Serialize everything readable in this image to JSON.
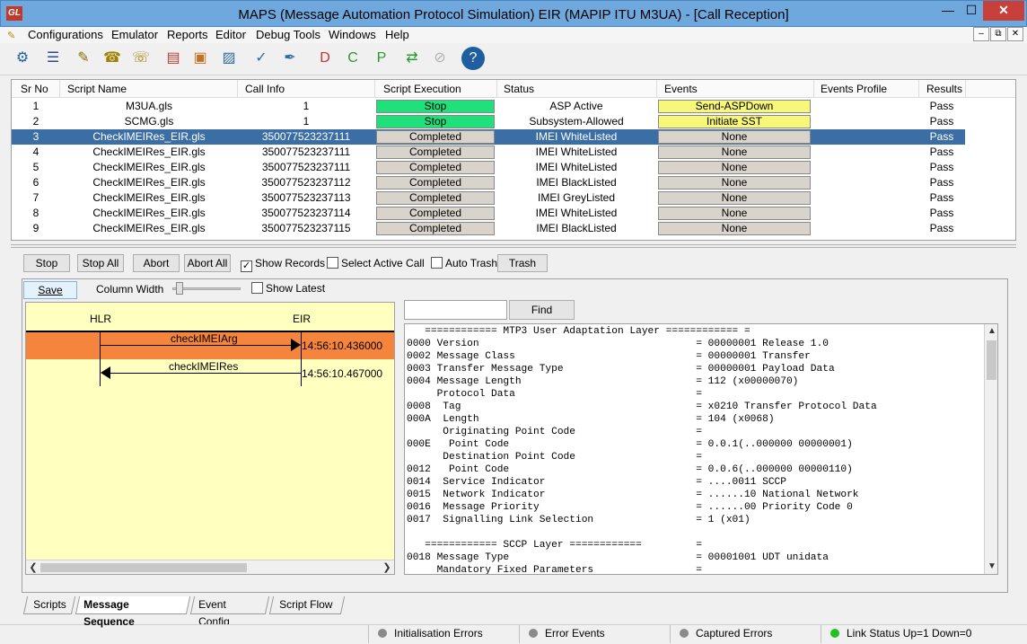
{
  "window": {
    "title": "MAPS (Message Automation Protocol Simulation) EIR (MAPIP ITU M3UA) - [Call Reception]",
    "app_icon": "GL",
    "min_glyph": "—",
    "max_glyph": "☐",
    "close_glyph": "✕"
  },
  "menu": [
    "Configurations",
    "Emulator",
    "Reports",
    "Editor",
    "Debug Tools",
    "Windows",
    "Help"
  ],
  "mdi": {
    "min": "–",
    "restore": "⧉",
    "close": "✕"
  },
  "toolbar": [
    {
      "icon": "gear-icon",
      "glyph": "⚙",
      "color": "#1f5fa0"
    },
    {
      "icon": "notebook-icon",
      "glyph": "☰",
      "color": "#2b4a8c"
    },
    {
      "icon": "script-edit-icon",
      "glyph": "✎",
      "color": "#8a6d00"
    },
    {
      "icon": "phone-icon",
      "glyph": "☎",
      "color": "#a08000"
    },
    {
      "icon": "phones-icon",
      "glyph": "☏",
      "color": "#a08000"
    },
    {
      "icon": "books-icon",
      "glyph": "▤",
      "color": "#c0392b"
    },
    {
      "icon": "briefcase-icon",
      "glyph": "▣",
      "color": "#c87020"
    },
    {
      "icon": "profile-lock-icon",
      "glyph": "▨",
      "color": "#2e6da4"
    },
    {
      "icon": "check-edit-icon",
      "glyph": "✓",
      "color": "#2e6da4"
    },
    {
      "icon": "pen-tool-icon",
      "glyph": "✒",
      "color": "#2e6da4"
    },
    {
      "icon": "record-d-icon",
      "glyph": "D",
      "color": "#d03030"
    },
    {
      "icon": "record-c-icon",
      "glyph": "C",
      "color": "#2a9a2a"
    },
    {
      "icon": "record-p-icon",
      "glyph": "P",
      "color": "#2a9a2a"
    },
    {
      "icon": "clock-arrow-icon",
      "glyph": "⇄",
      "color": "#2a9a2a"
    },
    {
      "icon": "disabled-tool-icon",
      "glyph": "⊘",
      "color": "#b0b0b0"
    },
    {
      "icon": "help-icon",
      "glyph": "?",
      "color": "#1f5fa0"
    }
  ],
  "grid": {
    "headers": [
      "Sr No",
      "Script Name",
      "Call Info",
      "Script Execution",
      "Status",
      "Events",
      "Events Profile",
      "Results"
    ],
    "rows": [
      {
        "sr": "1",
        "name": "M3UA.gls",
        "info": "1",
        "exec": "Stop",
        "status": "ASP Active",
        "events": "Send-ASPDown",
        "result": "Pass",
        "exec_style": "green",
        "events_style": "yellow"
      },
      {
        "sr": "2",
        "name": "SCMG.gls",
        "info": "1",
        "exec": "Stop",
        "status": "Subsystem-Allowed",
        "events": "Initiate SST",
        "result": "Pass",
        "exec_style": "green",
        "events_style": "yellow"
      },
      {
        "sr": "3",
        "name": "CheckIMEIRes_EIR.gls",
        "info": "350077523237111",
        "exec": "Completed",
        "status": "IMEI WhiteListed",
        "events": "None",
        "result": "Pass",
        "selected": true
      },
      {
        "sr": "4",
        "name": "CheckIMEIRes_EIR.gls",
        "info": "350077523237111",
        "exec": "Completed",
        "status": "IMEI WhiteListed",
        "events": "None",
        "result": "Pass"
      },
      {
        "sr": "5",
        "name": "CheckIMEIRes_EIR.gls",
        "info": "350077523237111",
        "exec": "Completed",
        "status": "IMEI WhiteListed",
        "events": "None",
        "result": "Pass"
      },
      {
        "sr": "6",
        "name": "CheckIMEIRes_EIR.gls",
        "info": "350077523237112",
        "exec": "Completed",
        "status": "IMEI BlackListed",
        "events": "None",
        "result": "Pass"
      },
      {
        "sr": "7",
        "name": "CheckIMEIRes_EIR.gls",
        "info": "350077523237113",
        "exec": "Completed",
        "status": "IMEI GreyListed",
        "events": "None",
        "result": "Pass"
      },
      {
        "sr": "8",
        "name": "CheckIMEIRes_EIR.gls",
        "info": "350077523237114",
        "exec": "Completed",
        "status": "IMEI WhiteListed",
        "events": "None",
        "result": "Pass"
      },
      {
        "sr": "9",
        "name": "CheckIMEIRes_EIR.gls",
        "info": "350077523237115",
        "exec": "Completed",
        "status": "IMEI BlackListed",
        "events": "None",
        "result": "Pass"
      }
    ]
  },
  "actions": {
    "stop": "Stop",
    "stop_all": "Stop All",
    "abort": "Abort",
    "abort_all": "Abort All",
    "show_records": "Show Records",
    "show_records_checked": true,
    "select_active_call": "Select Active Call",
    "auto_trash": "Auto Trash",
    "trash": "Trash"
  },
  "panel": {
    "save": "Save",
    "column_width": "Column Width",
    "show_latest": "Show Latest",
    "find": "Find",
    "find_value": ""
  },
  "sequence": {
    "nodes": [
      "HLR",
      "EIR"
    ],
    "messages": [
      {
        "label": "checkIMEIArg",
        "time": "14:56:10.436000",
        "direction": "right",
        "highlighted": true
      },
      {
        "label": "checkIMEIRes",
        "time": "14:56:10.467000",
        "direction": "left",
        "highlighted": false
      }
    ]
  },
  "decode": [
    "   ============ MTP3 User Adaptation Layer ============ =",
    "0000 Version                                    = 00000001 Release 1.0",
    "0002 Message Class                              = 00000001 Transfer",
    "0003 Transfer Message Type                      = 00000001 Payload Data",
    "0004 Message Length                             = 112 (x00000070)",
    "     Protocol Data                              =",
    "0008  Tag                                       = x0210 Transfer Protocol Data",
    "000A  Length                                    = 104 (x0068)",
    "      Originating Point Code                    =",
    "000E   Point Code                               = 0.0.1(..000000 00000001)",
    "      Destination Point Code                    =",
    "0012   Point Code                               = 0.0.6(..000000 00000110)",
    "0014  Service Indicator                         = ....0011 SCCP",
    "0015  Network Indicator                         = ......10 National Network",
    "0016  Message Priority                          = ......00 Priority Code 0",
    "0017  Signalling Link Selection                 = 1 (x01)",
    "",
    "   ============ SCCP Layer ============         =",
    "0018 Message Type                               = 00001001 UDT unidata",
    "     Mandatory Fixed Parameters                 ="
  ],
  "tabs": [
    "Scripts",
    "Message Sequence",
    "Event Config",
    "Script Flow"
  ],
  "active_tab": "Message Sequence",
  "status": [
    {
      "label": "Initialisation Errors",
      "state": "gray"
    },
    {
      "label": "Error Events",
      "state": "gray"
    },
    {
      "label": "Captured Errors",
      "state": "gray"
    },
    {
      "label": "Link Status Up=1 Down=0",
      "state": "green"
    }
  ]
}
